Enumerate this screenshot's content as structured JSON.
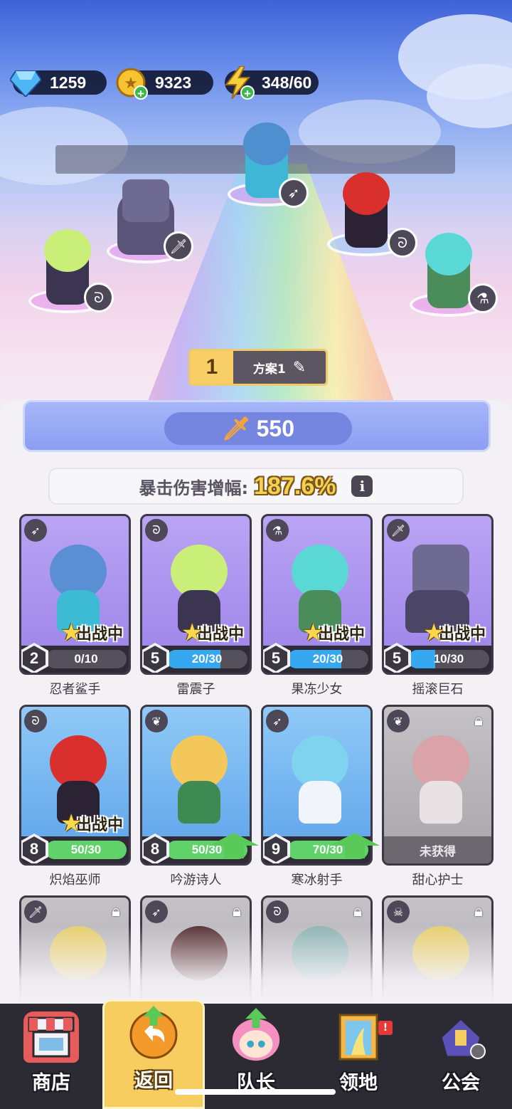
{
  "resources": {
    "gems": "1259",
    "coins": "9323",
    "energy": "348/60"
  },
  "plan": {
    "number": "1",
    "name": "方案1"
  },
  "power": "550",
  "crit": {
    "label": "暴击伤害增幅:",
    "value": "187.6%"
  },
  "deployed_label": "出战中",
  "heroes": [
    {
      "name": "忍者鲨手",
      "level": "2",
      "progress": "0/10",
      "progress_ratio": 0.0,
      "class": "bow-icon",
      "deployed": true
    },
    {
      "name": "雷震子",
      "level": "5",
      "progress": "20/30",
      "progress_ratio": 0.67,
      "class": "staff-icon",
      "deployed": true
    },
    {
      "name": "果冻少女",
      "level": "5",
      "progress": "20/30",
      "progress_ratio": 0.67,
      "class": "potion-icon",
      "deployed": true
    },
    {
      "name": "摇滚巨石",
      "level": "5",
      "progress": "10/30",
      "progress_ratio": 0.33,
      "class": "sword-icon",
      "deployed": true
    },
    {
      "name": "炽焰巫师",
      "level": "8",
      "progress": "50/30",
      "progress_ratio": 1.0,
      "class": "staff-icon",
      "deployed": true
    },
    {
      "name": "吟游诗人",
      "level": "8",
      "progress": "50/30",
      "progress_ratio": 1.0,
      "class": "wings-icon",
      "deployed": false,
      "upgrade": true
    },
    {
      "name": "寒冰射手",
      "level": "9",
      "progress": "70/30",
      "progress_ratio": 1.0,
      "class": "bow-icon",
      "deployed": false,
      "upgrade": true
    },
    {
      "name": "甜心护士",
      "status": "未获得",
      "class": "wings-icon",
      "locked": true
    }
  ],
  "nav": {
    "shop": "商店",
    "back": "返回",
    "captain": "队长",
    "territory": "领地",
    "guild": "公会",
    "territory_alert": "!"
  }
}
